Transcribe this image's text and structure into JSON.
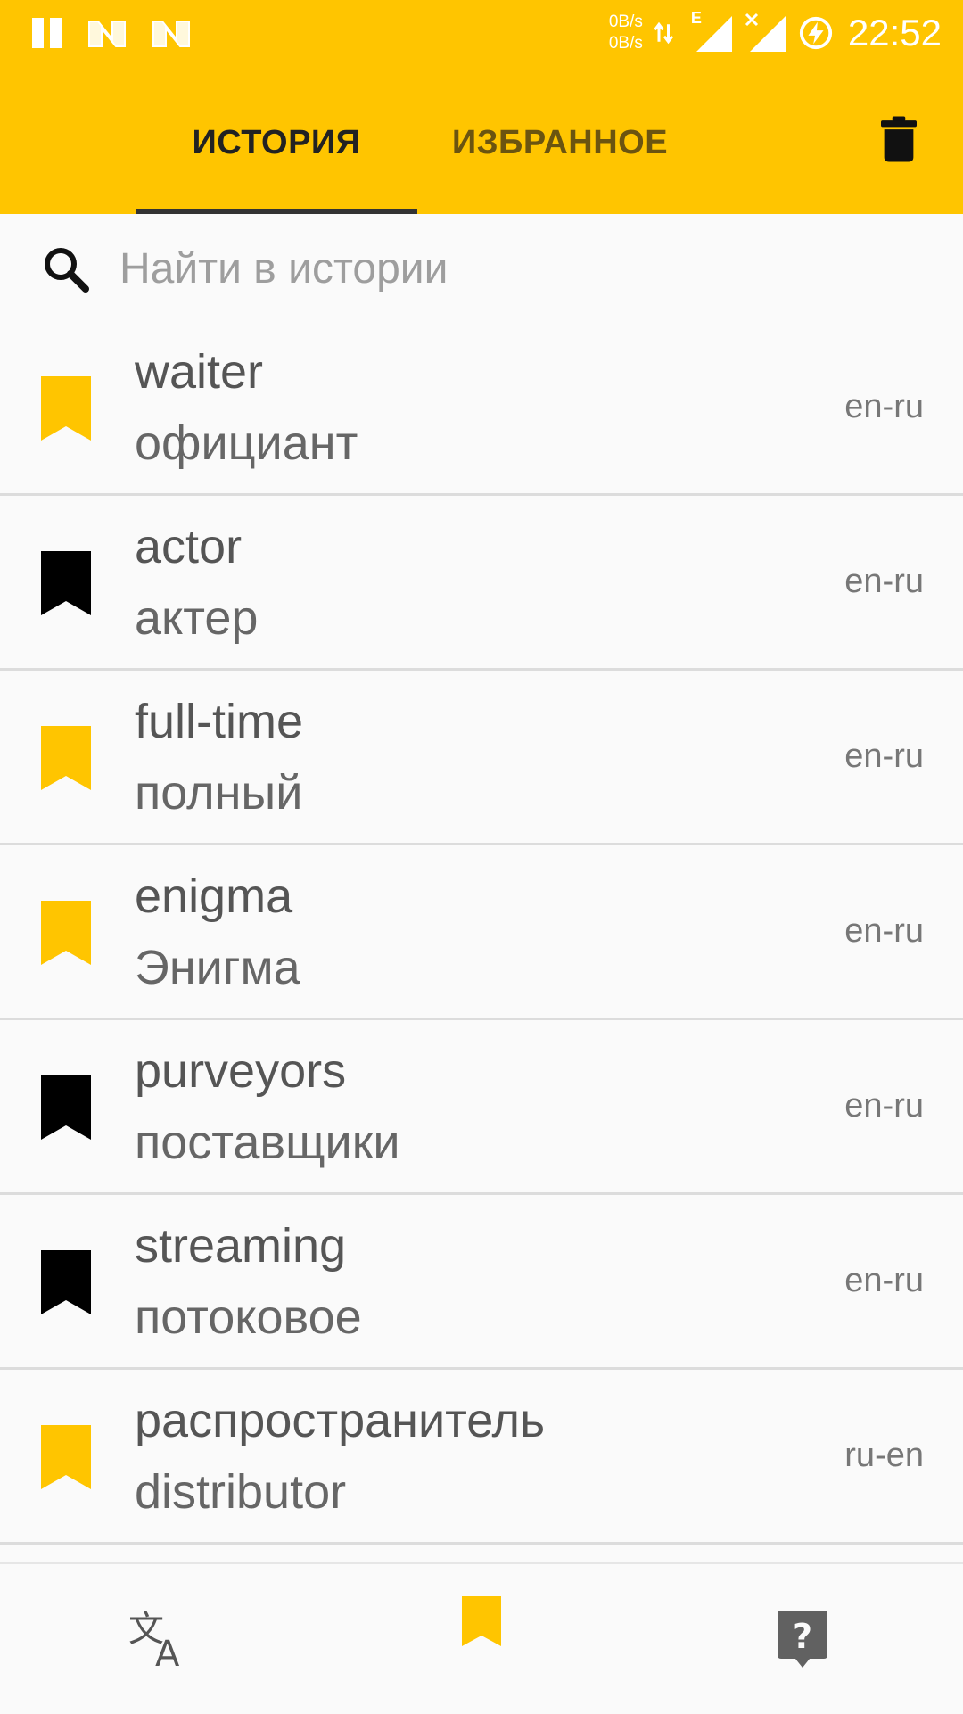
{
  "status_bar": {
    "time": "22:52",
    "upload_speed": "0B/s",
    "download_speed": "0B/s",
    "network_type": "E",
    "icons": [
      "pause-icon",
      "notification-n-icon",
      "notification-n-icon",
      "data-arrows-icon",
      "signal-icon",
      "no-signal-icon",
      "battery-charging-icon"
    ]
  },
  "tabs": [
    {
      "label": "ИСТОРИЯ",
      "selected": true
    },
    {
      "label": "ИЗБРАННОЕ",
      "selected": false
    }
  ],
  "header": {
    "trash_icon": "trash-icon"
  },
  "search": {
    "placeholder": "Найти в истории",
    "value": ""
  },
  "history": [
    {
      "word": "waiter",
      "translation": "официант",
      "lang": "en-ru",
      "favorite": true
    },
    {
      "word": "actor",
      "translation": "актер",
      "lang": "en-ru",
      "favorite": false
    },
    {
      "word": "full-time",
      "translation": "полный",
      "lang": "en-ru",
      "favorite": true
    },
    {
      "word": "enigma",
      "translation": "Энигма",
      "lang": "en-ru",
      "favorite": true
    },
    {
      "word": "purveyors",
      "translation": "поставщики",
      "lang": "en-ru",
      "favorite": false
    },
    {
      "word": "streaming",
      "translation": "потоковое",
      "lang": "en-ru",
      "favorite": false
    },
    {
      "word": "распространитель",
      "translation": "distributor",
      "lang": "ru-en",
      "favorite": true
    }
  ],
  "bottom_nav": [
    {
      "icon": "translate-icon",
      "active": false
    },
    {
      "icon": "bookmark-icon",
      "active": true
    },
    {
      "icon": "help-icon",
      "active": false
    }
  ],
  "colors": {
    "accent": "#ffc500",
    "favorite": "#ffc500",
    "not_favorite": "#000000",
    "help_icon": "#616161"
  }
}
